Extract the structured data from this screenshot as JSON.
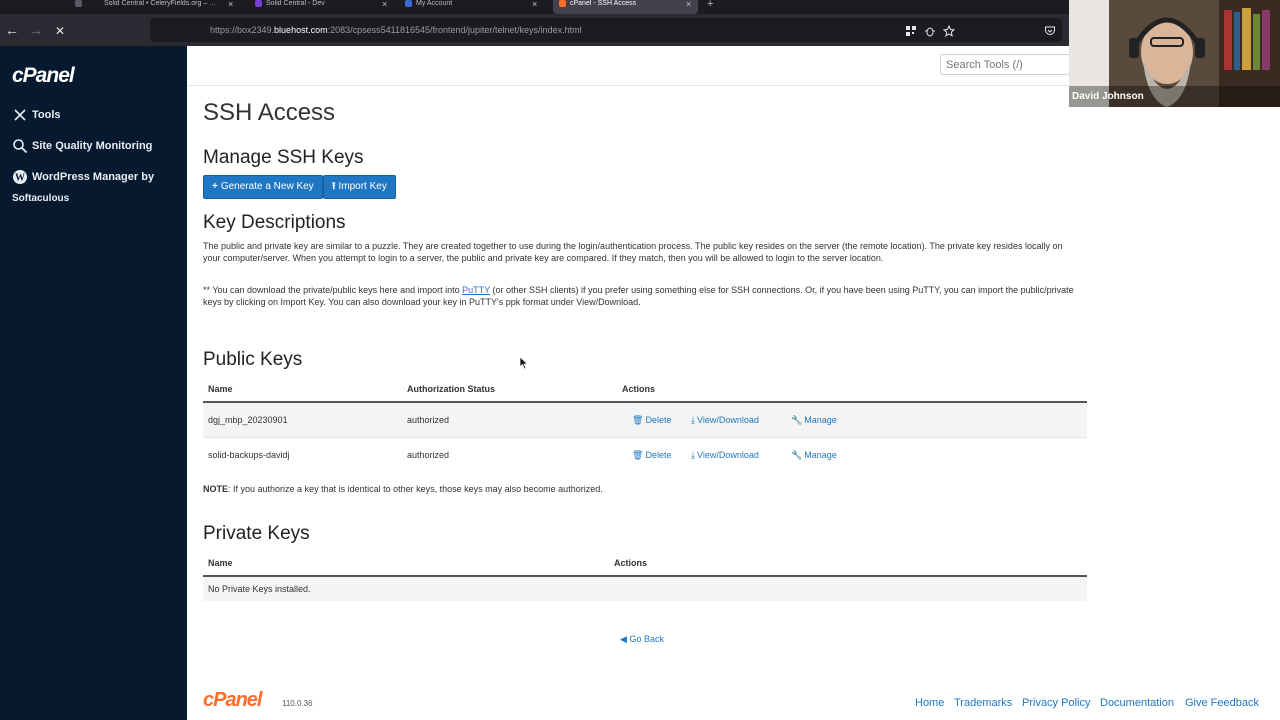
{
  "browser": {
    "tabs": [
      {
        "title": "Solid Central • CeleryFields.org – …",
        "color": "#4b4b57"
      },
      {
        "title": "Solid Central - Dev",
        "color": "#7b3fd6"
      },
      {
        "title": "My Account",
        "color": "#3b6ad8"
      },
      {
        "title": "cPanel - SSH Access",
        "color": "#ff6c2c"
      }
    ],
    "url_prefix": "https://box2349.",
    "url_domain": "bluehost.com",
    "url_suffix": ":2083/cpsess5411816545/frontend/jupiter/telnet/keys/index.html"
  },
  "sidebar": {
    "logo": "cPanel",
    "items": [
      {
        "label": "Tools",
        "icon": "tools-icon"
      },
      {
        "label": "Site Quality Monitoring",
        "icon": "search-icon"
      },
      {
        "label": "WordPress Manager by",
        "label2": "Softaculous",
        "icon": "wordpress-icon"
      }
    ]
  },
  "search": {
    "placeholder": "Search Tools (/)"
  },
  "page": {
    "title": "SSH Access",
    "manage_heading": "Manage SSH Keys",
    "generate_label": "Generate a New Key",
    "import_label": "Import Key",
    "desc_heading": "Key Descriptions",
    "desc_para1": "The public and private key are similar to a puzzle. They are created together to use during the login/authentication process. The public key resides on the server (the remote location). The private key resides locally on your computer/server. When you attempt to login to a server, the public and private key are compared. If they match, then you will be allowed to login to the server location.",
    "desc_para2_a": "** You can download the private/public keys here and import into ",
    "desc_para2_link": "PuTTY",
    "desc_para2_b": " (or other SSH clients) if you prefer using something else for SSH connections. Or, if you have been using PuTTY, you can import the public/private keys by clicking on Import Key. You can also download your key in PuTTY's ppk format under View/Download.",
    "public_heading": "Public Keys",
    "public_cols": {
      "name": "Name",
      "status": "Authorization Status",
      "actions": "Actions"
    },
    "public_rows": [
      {
        "name": "dgj_mbp_20230901",
        "status": "authorized"
      },
      {
        "name": "solid-backups-davidj",
        "status": "authorized"
      }
    ],
    "actions": {
      "delete": "Delete",
      "view": "View/Download",
      "manage": "Manage"
    },
    "note_bold": "NOTE",
    "note_text": ": If you authorize a key that is identical to other keys, those keys may also become authorized.",
    "private_heading": "Private Keys",
    "private_cols": {
      "name": "Name",
      "actions": "Actions"
    },
    "private_empty": "No Private Keys installed.",
    "go_back": "Go Back"
  },
  "footer": {
    "logo": "cPanel",
    "version": "110.0.36",
    "links": [
      "Home",
      "Trademarks",
      "Privacy Policy",
      "Documentation",
      "Give Feedback"
    ]
  },
  "webcam": {
    "name": "David Johnson"
  }
}
